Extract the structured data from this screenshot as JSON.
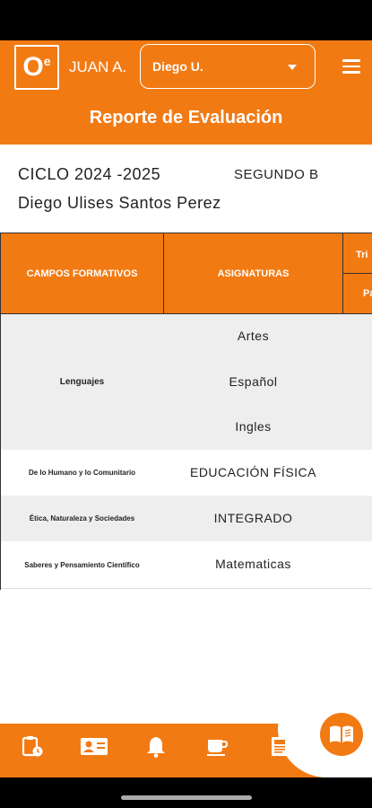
{
  "header": {
    "logo_letter": "O",
    "logo_superscript": "e",
    "user_name": "JUAN A.",
    "student_select_value": "Diego U.",
    "report_title": "Reporte de Evaluación"
  },
  "info": {
    "cycle": "CICLO 2024 -2025",
    "group": "SEGUNDO B",
    "student_name": "Diego Ulises Santos Perez"
  },
  "table": {
    "headers": {
      "fields": "CAMPOS FORMATIVOS",
      "subjects": "ASIGNATURAS",
      "trimester": "Tri",
      "partial": "Pa"
    },
    "rows": [
      {
        "field": "Lenguajes",
        "subjects": [
          "Artes",
          "Español",
          "Ingles"
        ]
      },
      {
        "field": "De lo Humano y lo Comunitario",
        "subjects": [
          "EDUCACIÓN FÍSICA"
        ]
      },
      {
        "field": "Ética, Naturaleza y Sociedades",
        "subjects": [
          "INTEGRADO"
        ]
      },
      {
        "field": "Saberes y Pensamiento Científico",
        "subjects": [
          "Matematicas"
        ]
      }
    ]
  },
  "footer": {
    "icons": [
      "clipboard-clock-icon",
      "contact-card-icon",
      "bell-icon",
      "coffee-cup-icon",
      "newspaper-icon",
      "open-book-icon"
    ]
  },
  "colors": {
    "accent": "#f27a13",
    "stripe": "#eeeeee"
  }
}
